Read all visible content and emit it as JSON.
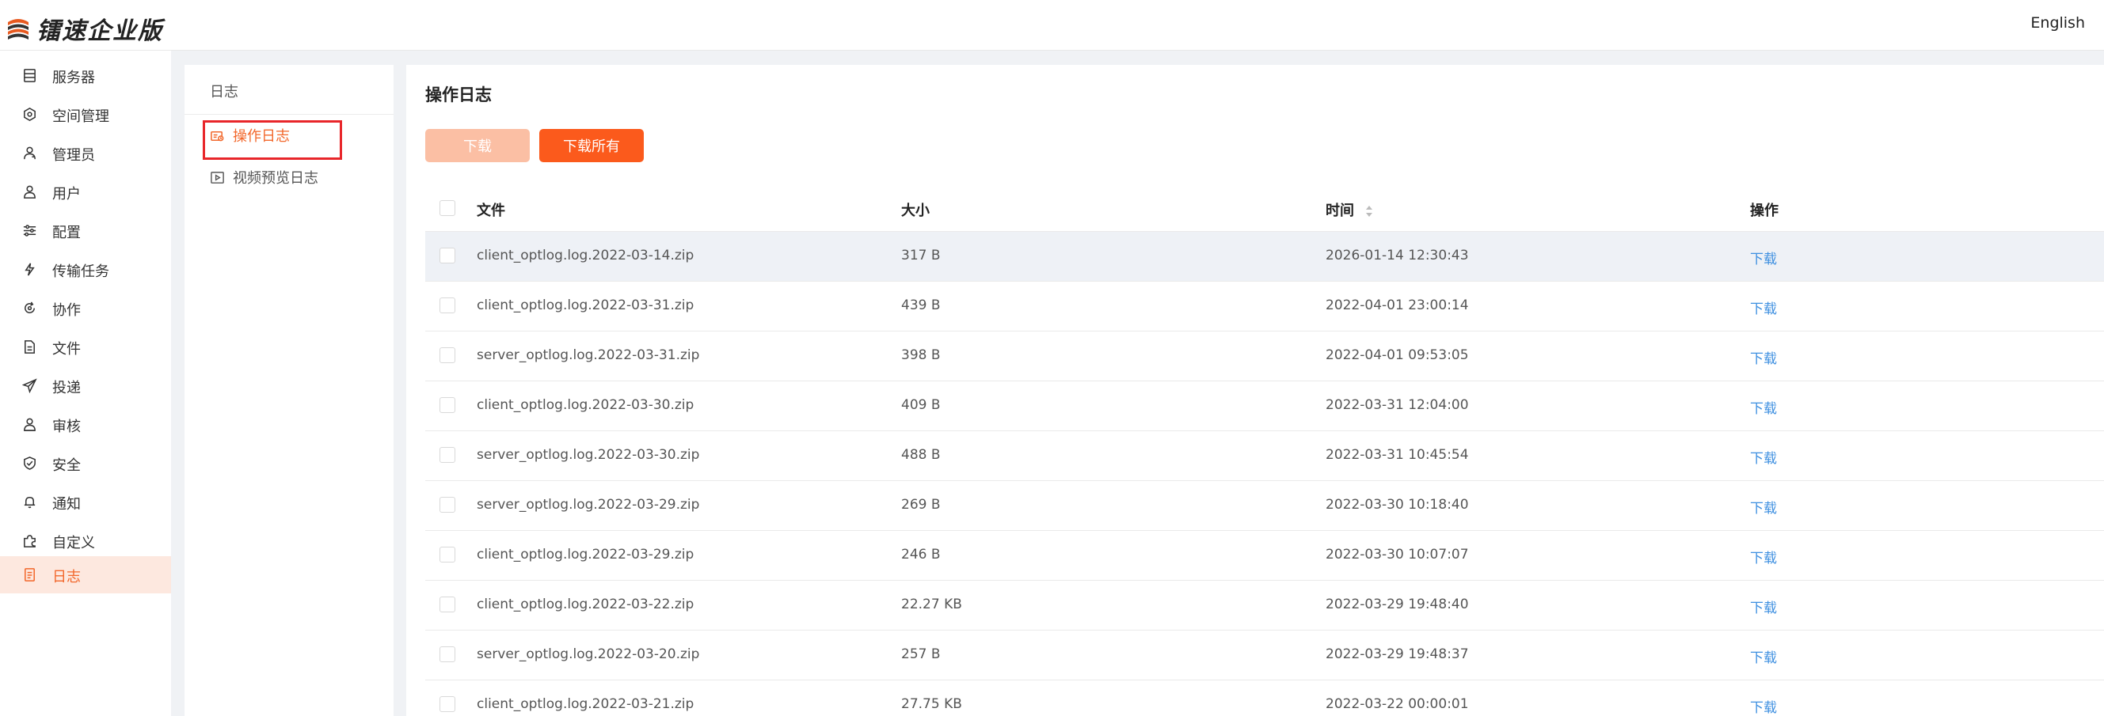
{
  "header": {
    "logo_text": "镭速企业版",
    "language": "English"
  },
  "sidebar": {
    "items": [
      {
        "label": "服务器",
        "icon": "server-icon"
      },
      {
        "label": "空间管理",
        "icon": "space-icon"
      },
      {
        "label": "管理员",
        "icon": "admin-icon"
      },
      {
        "label": "用户",
        "icon": "user-icon"
      },
      {
        "label": "配置",
        "icon": "sliders-icon"
      },
      {
        "label": "传输任务",
        "icon": "transfer-icon"
      },
      {
        "label": "协作",
        "icon": "collab-icon"
      },
      {
        "label": "文件",
        "icon": "file-icon"
      },
      {
        "label": "投递",
        "icon": "send-icon"
      },
      {
        "label": "审核",
        "icon": "audit-icon"
      },
      {
        "label": "安全",
        "icon": "shield-icon"
      },
      {
        "label": "通知",
        "icon": "bell-icon"
      },
      {
        "label": "自定义",
        "icon": "puzzle-icon"
      },
      {
        "label": "日志",
        "icon": "log-icon",
        "active": true
      }
    ]
  },
  "subnav": {
    "title": "日志",
    "items": [
      {
        "label": "操作日志",
        "active": true
      },
      {
        "label": "视频预览日志"
      }
    ]
  },
  "main": {
    "title": "操作日志",
    "buttons": {
      "download": "下载",
      "download_all": "下载所有"
    },
    "table": {
      "columns": [
        "文件",
        "大小",
        "时间",
        "操作"
      ],
      "rows": [
        {
          "file": "client_optlog.log.2022-03-14.zip",
          "size": "317 B",
          "time": "2026-01-14 12:30:43",
          "action": "下载"
        },
        {
          "file": "client_optlog.log.2022-03-31.zip",
          "size": "439 B",
          "time": "2022-04-01 23:00:14",
          "action": "下载"
        },
        {
          "file": "server_optlog.log.2022-03-31.zip",
          "size": "398 B",
          "time": "2022-04-01 09:53:05",
          "action": "下载"
        },
        {
          "file": "client_optlog.log.2022-03-30.zip",
          "size": "409 B",
          "time": "2022-03-31 12:04:00",
          "action": "下载"
        },
        {
          "file": "server_optlog.log.2022-03-30.zip",
          "size": "488 B",
          "time": "2022-03-31 10:45:54",
          "action": "下载"
        },
        {
          "file": "server_optlog.log.2022-03-29.zip",
          "size": "269 B",
          "time": "2022-03-30 10:18:40",
          "action": "下载"
        },
        {
          "file": "client_optlog.log.2022-03-29.zip",
          "size": "246 B",
          "time": "2022-03-30 10:07:07",
          "action": "下载"
        },
        {
          "file": "client_optlog.log.2022-03-22.zip",
          "size": "22.27 KB",
          "time": "2022-03-29 19:48:40",
          "action": "下载"
        },
        {
          "file": "server_optlog.log.2022-03-20.zip",
          "size": "257 B",
          "time": "2022-03-29 19:48:37",
          "action": "下载"
        },
        {
          "file": "client_optlog.log.2022-03-21.zip",
          "size": "27.75 KB",
          "time": "2022-03-22 00:00:01",
          "action": "下载"
        }
      ]
    }
  },
  "colors": {
    "accent": "#fb5a1c",
    "accent_light": "#fbbfa4",
    "link": "#3d8fe0",
    "active_bg": "#fde8df",
    "highlight_border": "#e8262a"
  }
}
